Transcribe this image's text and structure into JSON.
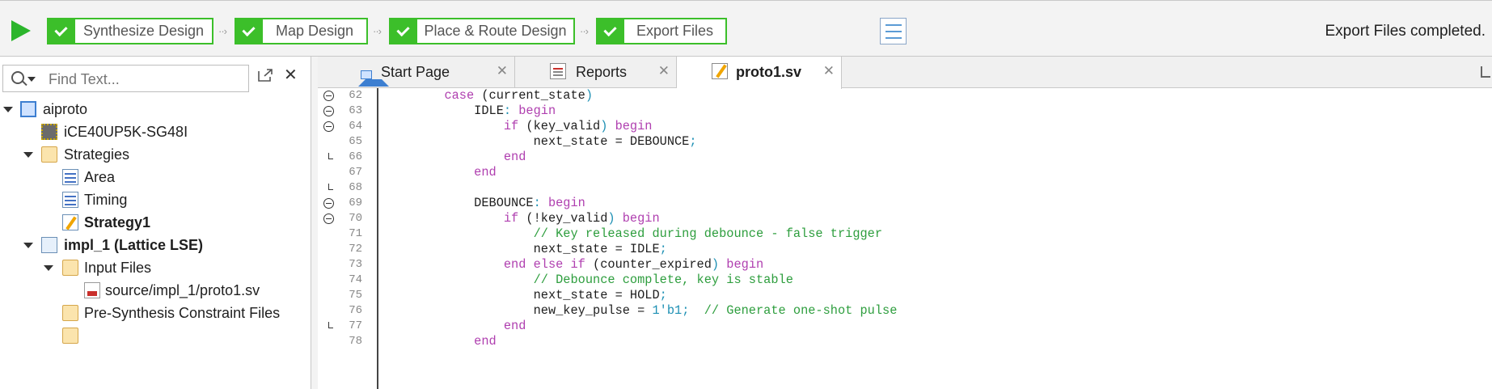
{
  "toolbar": {
    "steps": [
      {
        "label": "Synthesize Design"
      },
      {
        "label": "Map Design"
      },
      {
        "label": "Place & Route Design"
      },
      {
        "label": "Export Files"
      }
    ],
    "status": "Export Files completed."
  },
  "left_pane": {
    "search_placeholder": "Find Text...",
    "tree": [
      {
        "label": "aiproto",
        "icon": "project-icon"
      },
      {
        "label": "iCE40UP5K-SG48I",
        "icon": "device-chip-icon"
      },
      {
        "label": "Strategies",
        "icon": "folder-icon"
      },
      {
        "label": "Area",
        "icon": "strategy-icon"
      },
      {
        "label": "Timing",
        "icon": "strategy-icon"
      },
      {
        "label": "Strategy1",
        "icon": "strategy-edit-icon"
      },
      {
        "label": "impl_1 (Lattice LSE)",
        "icon": "implementation-icon"
      },
      {
        "label": "Input Files",
        "icon": "folder-icon"
      },
      {
        "label": "source/impl_1/proto1.sv",
        "icon": "sv-file-icon"
      },
      {
        "label": "Pre-Synthesis Constraint Files",
        "icon": "folder-icon"
      }
    ]
  },
  "tabs": [
    {
      "label": "Start Page",
      "icon": "home-icon",
      "active": false
    },
    {
      "label": "Reports",
      "icon": "report-icon",
      "active": false
    },
    {
      "label": "proto1.sv",
      "icon": "edit-file-icon",
      "active": true
    }
  ],
  "code": {
    "line_numbers": [
      "62",
      "63",
      "64",
      "65",
      "66",
      "67",
      "68",
      "69",
      "70",
      "71",
      "72",
      "73",
      "74",
      "75",
      "76",
      "77",
      "78"
    ],
    "lines": [
      [
        [
          "        ",
          ""
        ],
        [
          "case",
          "k"
        ],
        [
          " (",
          ""
        ],
        [
          "current_state",
          ""
        ],
        [
          ")",
          "p"
        ]
      ],
      [
        [
          "            IDLE",
          ""
        ],
        [
          ": ",
          "p"
        ],
        [
          "begin",
          "k"
        ]
      ],
      [
        [
          "                ",
          ""
        ],
        [
          "if",
          "k"
        ],
        [
          " (",
          ""
        ],
        [
          "key_valid",
          ""
        ],
        [
          ") ",
          "p"
        ],
        [
          "begin",
          "k"
        ]
      ],
      [
        [
          "                    next_state = DEBOUNCE",
          ""
        ],
        [
          ";",
          "p"
        ]
      ],
      [
        [
          "                ",
          ""
        ],
        [
          "end",
          "k"
        ]
      ],
      [
        [
          "            ",
          ""
        ],
        [
          "end",
          "k"
        ]
      ],
      [
        [
          "",
          ""
        ]
      ],
      [
        [
          "            DEBOUNCE",
          ""
        ],
        [
          ": ",
          "p"
        ],
        [
          "begin",
          "k"
        ]
      ],
      [
        [
          "                ",
          ""
        ],
        [
          "if",
          "k"
        ],
        [
          " (",
          ""
        ],
        [
          "!key_valid",
          ""
        ],
        [
          ") ",
          "p"
        ],
        [
          "begin",
          "k"
        ]
      ],
      [
        [
          "                    ",
          ""
        ],
        [
          "// Key released during debounce - false trigger",
          "c"
        ]
      ],
      [
        [
          "                    next_state = IDLE",
          ""
        ],
        [
          ";",
          "p"
        ]
      ],
      [
        [
          "                ",
          ""
        ],
        [
          "end else if",
          "k"
        ],
        [
          " (",
          ""
        ],
        [
          "counter_expired",
          ""
        ],
        [
          ") ",
          "p"
        ],
        [
          "begin",
          "k"
        ]
      ],
      [
        [
          "                    ",
          ""
        ],
        [
          "// Debounce complete, key is stable",
          "c"
        ]
      ],
      [
        [
          "                    next_state = HOLD",
          ""
        ],
        [
          ";",
          "p"
        ]
      ],
      [
        [
          "                    new_key_pulse = ",
          ""
        ],
        [
          "1'b1",
          "n"
        ],
        [
          ";  ",
          "p"
        ],
        [
          "// Generate one-shot pulse",
          "c"
        ]
      ],
      [
        [
          "                ",
          ""
        ],
        [
          "end",
          "k"
        ]
      ],
      [
        [
          "            ",
          ""
        ],
        [
          "end",
          "k"
        ]
      ]
    ]
  }
}
